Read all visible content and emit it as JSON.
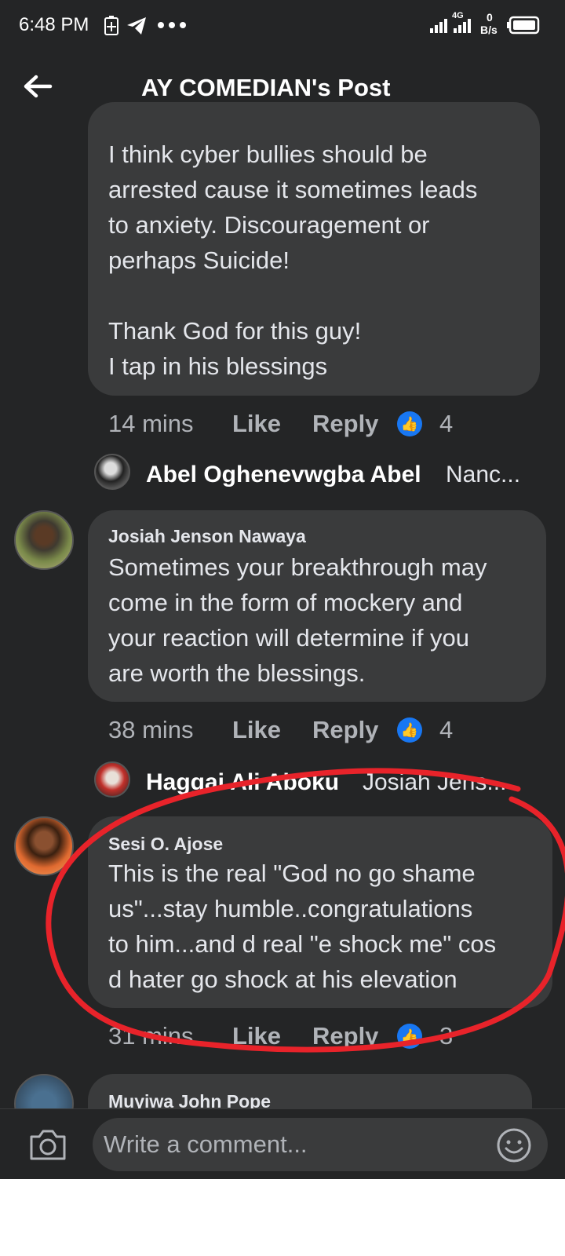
{
  "status_bar": {
    "time": "6:48 PM",
    "network": "4G",
    "speed_value": "0",
    "speed_unit": "B/s"
  },
  "header": {
    "title": "AY COMEDIAN's Post"
  },
  "comments": [
    {
      "text": "I think cyber bullies should be\narrested cause it sometimes leads\nto anxiety.  Discouragement or\nperhaps Suicide!\n\nThank God for this guy!\nI tap in his blessings",
      "time": "14 mins",
      "like": "Like",
      "reply": "Reply",
      "likes": "4",
      "reply_preview": {
        "name": "Abel Oghenevwgba Abel",
        "text": "Nanc..."
      }
    },
    {
      "author": "Josiah Jenson Nawaya",
      "text": "Sometimes your breakthrough may\ncome in the form of mockery and\nyour reaction will determine if you\nare worth the blessings.",
      "time": "38 mins",
      "like": "Like",
      "reply": "Reply",
      "likes": "4",
      "reply_preview": {
        "name": "Haggai Ali Aboku",
        "text": "Josiah Jens..."
      }
    },
    {
      "author": "Sesi O. Ajose",
      "text": "This is the real \"God no go shame\nus\"...stay humble..congratulations\nto him...and d real \"e shock me\" cos\nd hater go shock at his elevation",
      "time": "31 mins",
      "like": "Like",
      "reply": "Reply",
      "likes": "3"
    },
    {
      "author": "Muyiwa John Pope"
    }
  ],
  "composer": {
    "placeholder": "Write a comment..."
  },
  "colors": {
    "background": "#242526",
    "bubble": "#3a3b3c",
    "like_blue": "#1877f2",
    "annotation_red": "#e8232a"
  }
}
